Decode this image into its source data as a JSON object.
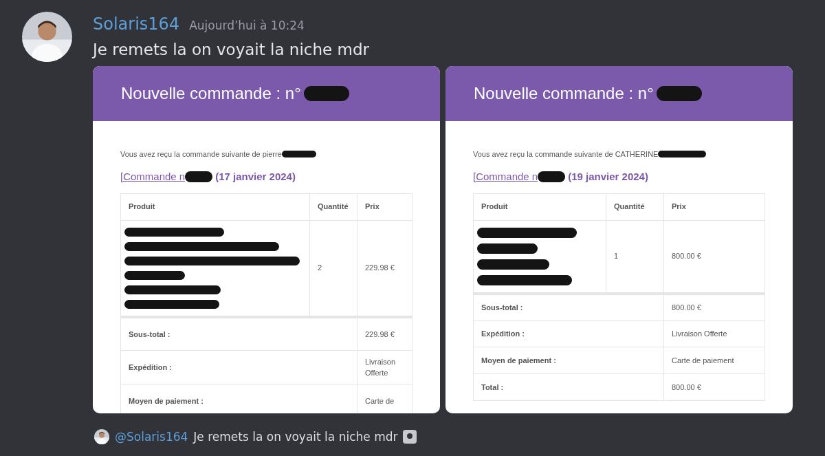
{
  "message": {
    "author": "Solaris164",
    "timestamp": "Aujourd’hui à 10:24",
    "text": "Je remets la on voyait la niche mdr"
  },
  "emails": [
    {
      "title": "Nouvelle commande : n°",
      "intro": "Vous avez reçu la commande suivante de pierre",
      "order_link": "[Commande n",
      "order_date": "(17 janvier 2024)",
      "columns": [
        "Produit",
        "Quantité",
        "Prix"
      ],
      "item": {
        "quantity": "2",
        "price": "229.98 €"
      },
      "totals": [
        {
          "label": "Sous-total :",
          "value": "229.98 €"
        },
        {
          "label": "Expédition :",
          "value": "Livraison Offerte"
        },
        {
          "label": "Moyen de paiement :",
          "value": "Carte de"
        }
      ]
    },
    {
      "title": "Nouvelle commande : n°",
      "intro": "Vous avez reçu la commande suivante de CATHERINE",
      "order_link": "[Commande n",
      "order_date": "(19 janvier 2024)",
      "columns": [
        "Produit",
        "Quantité",
        "Prix"
      ],
      "item": {
        "quantity": "1",
        "price": "800.00 €"
      },
      "totals": [
        {
          "label": "Sous-total :",
          "value": "800.00 €"
        },
        {
          "label": "Expédition :",
          "value": "Livraison Offerte"
        },
        {
          "label": "Moyen de paiement :",
          "value": "Carte de paiement"
        },
        {
          "label": "Total :",
          "value": "800.00 €"
        }
      ]
    }
  ],
  "reply": {
    "mention": "@Solaris164",
    "text": "Je remets la on voyait la niche mdr"
  }
}
